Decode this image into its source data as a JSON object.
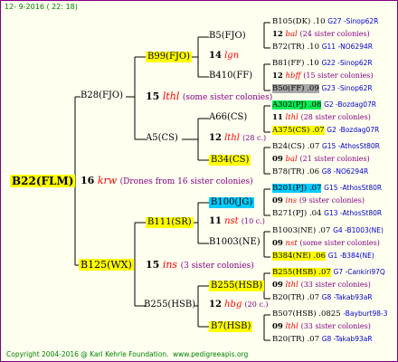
{
  "header": {
    "date": "12-  9-2016 ( 22: 18)"
  },
  "footer": {
    "copyright": "Copyright 2004-2016 @ Karl Kehrle Foundation.",
    "website": "www.pedigreeapis.org"
  },
  "root": {
    "name": "B22(FLM)",
    "num": "16",
    "code": "krw",
    "note": "(Drones from 16 sister colonies)"
  },
  "g1": {
    "sire": {
      "name": "B28(FJO)",
      "num": "15",
      "code": "lthl",
      "note": "(some sister colonies)"
    },
    "dam": {
      "name": "B125(WX)",
      "num": "15",
      "code": "ins",
      "note": "(3 sister colonies)"
    }
  },
  "g2": {
    "a": {
      "name": "B99(FJO)",
      "num": "14",
      "code": "lgn"
    },
    "b": {
      "name": "A5(CS)",
      "num": "12",
      "code": "lthl",
      "note": "(28 c.)"
    },
    "c": {
      "name": "B111(SR)",
      "num": "11",
      "code": "nst",
      "note": "(10 c.)"
    },
    "d": {
      "name": "B255(HSB)",
      "num": "12",
      "code": "hbg",
      "note": "(20 c.)"
    }
  },
  "g3": {
    "a1": {
      "name": "B5(FJO)"
    },
    "a2": {
      "name": "B410(FF)"
    },
    "b1": {
      "name": "A66(CS)",
      "num": "11",
      "code": "lthl",
      "note": "(28 c.)"
    },
    "b2": {
      "name": "B34(CS)"
    },
    "c1": {
      "name": "B100(JG)"
    },
    "c2": {
      "name": "B1003(NE)"
    },
    "d1": {
      "name": "B255(HSB)"
    },
    "d2": {
      "name": "B7(HSB)"
    }
  },
  "g4": [
    {
      "name": "B105(DK)",
      "val": ".10",
      "loc": "G27 -Sinop62R"
    },
    {
      "num": "12",
      "code": "bal",
      "note": "(24 sister colonies)"
    },
    {
      "name": "B72(TR)",
      "val": ".10",
      "loc": "G11 -NO6294R"
    },
    {
      "name": "B81(FF)",
      "val": ".10",
      "loc": "G22 -Sinop62R"
    },
    {
      "num": "12",
      "code": "hbff",
      "note": "(15 sister colonies)"
    },
    {
      "name": "B50(FF)",
      "val": ".09",
      "loc": "G23 -Sinop62R"
    },
    {
      "name": "A302(PJ)",
      "val": ".08",
      "loc": "G2 -Bozdag07R"
    },
    {
      "num": "11",
      "code": "lthl",
      "note": "(28 sister colonies)"
    },
    {
      "name": "A375(CS)",
      "val": ".07",
      "loc": "G2 -Bozdag07R"
    },
    {
      "name": "B24(CS)",
      "val": ".07",
      "loc": "G15 -AthosSt80R"
    },
    {
      "num": "09",
      "code": "bal",
      "note": "(21 sister colonies)"
    },
    {
      "name": "B78(TR)",
      "val": ".06",
      "loc": "G8 -NO6294R"
    },
    {
      "name": "B201(PJ)",
      "val": ".07",
      "loc": "G15 -AthosSt80R"
    },
    {
      "num": "09",
      "code": "ins",
      "note": "(9 sister colonies)"
    },
    {
      "name": "B271(PJ)",
      "val": ".04",
      "loc": "G13 -AthosSt80R"
    },
    {
      "name": "B1003(NE)",
      "val": ".07",
      "loc": "G4 -B1003(NE)"
    },
    {
      "num": "09",
      "code": "nst",
      "note": "(some sister colonies)"
    },
    {
      "name": "B384(NE)",
      "val": ".06",
      "loc": "G1 -B384(NE)"
    },
    {
      "name": "B255(HSB)",
      "val": ".07",
      "loc": "G7 -Cankiri97Q"
    },
    {
      "num": "09",
      "code": "lthl",
      "note": "(33 sister colonies)"
    },
    {
      "name": "B20(TR)",
      "val": ".07",
      "loc": "G8 -Takab93aR"
    },
    {
      "name": "B507(HSB)",
      "val": ".0825",
      "loc": "-Bayburt98-3"
    },
    {
      "num": "09",
      "code": "lthl",
      "note": "(33 sister colonies)"
    },
    {
      "name": "B20(TR)",
      "val": ".07",
      "loc": "G8 -Takab93aR"
    }
  ],
  "colors": {
    "frame": "#800080",
    "line": "#000000",
    "highlight": "#ffff00",
    "cyan": "#00ccff",
    "green": "#00ee55",
    "grey": "#a8a8a8",
    "code": "#ff0000",
    "sister": "#800080",
    "header": "#008000",
    "loc": "#0000cc"
  }
}
